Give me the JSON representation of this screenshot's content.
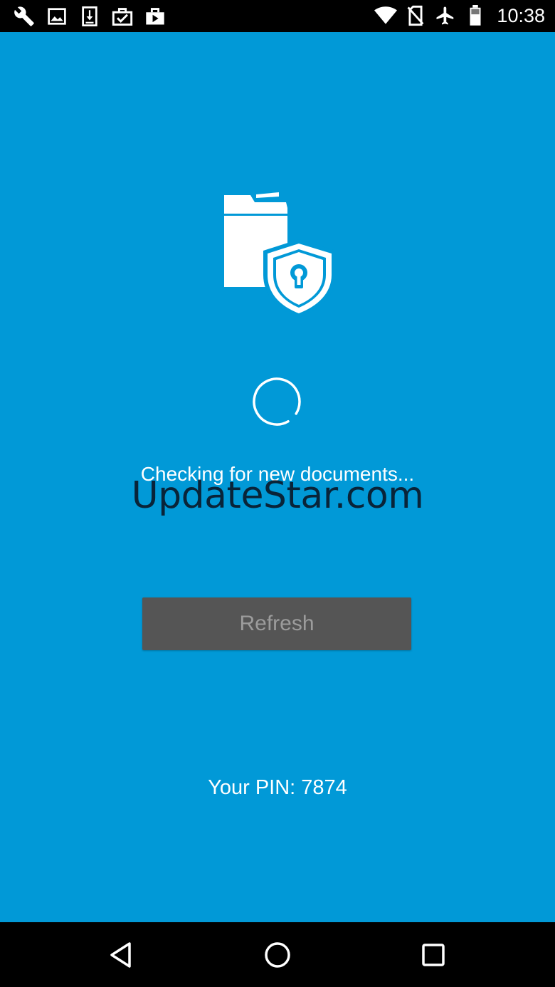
{
  "status_bar": {
    "left_icons": [
      "wrench-icon",
      "image-icon",
      "download-icon",
      "briefcase-check-icon",
      "briefcase-play-icon"
    ],
    "right_icons": [
      "wifi-icon",
      "no-sim-icon",
      "airplane-icon",
      "battery-icon"
    ],
    "time": "10:38"
  },
  "main": {
    "logo_icon": "document-shield-lock-icon",
    "spinner_icon": "loading-spinner-icon",
    "status_message": "Checking for new documents...",
    "watermark": "UpdateStar.com",
    "refresh_label": "Refresh",
    "pin_label": "Your PIN: ",
    "pin_value": "7874"
  },
  "nav_bar": {
    "buttons": [
      "back-icon",
      "home-icon",
      "recents-icon"
    ]
  },
  "colors": {
    "background": "#0199d7",
    "button_bg": "#555555",
    "button_text": "#9c9c9c",
    "text": "#ffffff"
  }
}
